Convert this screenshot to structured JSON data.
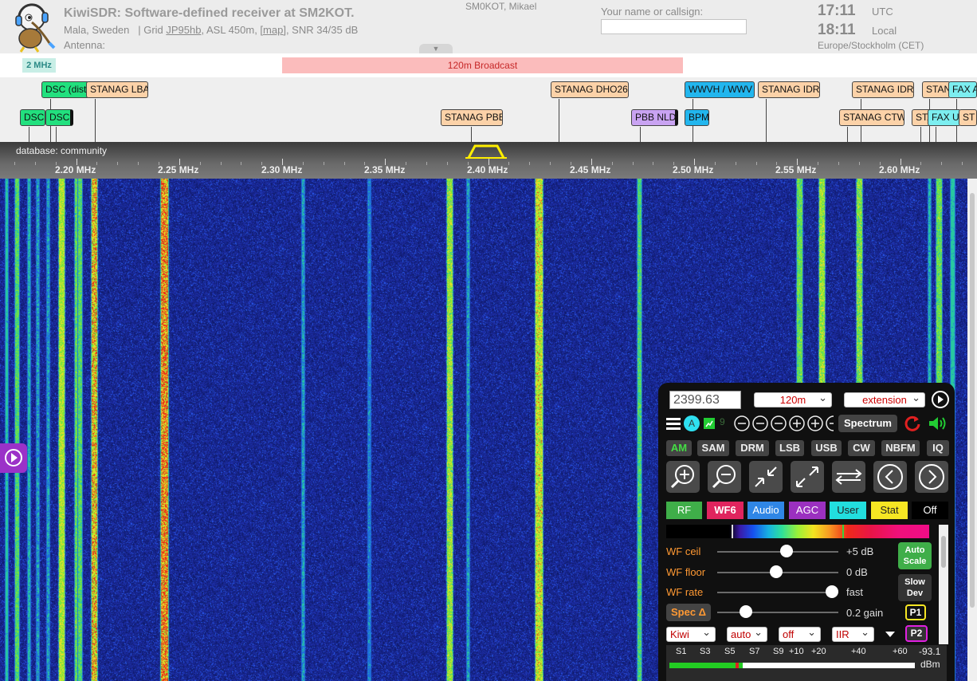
{
  "header": {
    "title": "KiwiSDR: Software-defined receiver at SM2KOT.",
    "location_prefix": "Mala, Sweden   | Grid ",
    "grid": "JP95hb",
    "asl": ", ASL 450m, ",
    "map": "[map]",
    "snr": ", SNR 34/35 dB",
    "antenna": "Antenna:",
    "owner": "SM0KOT, Mikael",
    "callsign_label": "Your name or callsign:",
    "callsign_value": "",
    "utc_time": "17:11",
    "utc_label": "UTC",
    "local_time": "18:11",
    "local_label": "Local",
    "timezone": "Europe/Stockholm (CET)"
  },
  "bands": {
    "left_label": "2 MHz",
    "broadcast_label": "120m Broadcast"
  },
  "station_labels": [
    {
      "text": "DSC (distress)",
      "color": "green"
    },
    {
      "text": "STANAG LBA",
      "color": "tan"
    },
    {
      "text": "DSC",
      "color": "green"
    },
    {
      "text": "DSC",
      "color": "green"
    },
    {
      "text": "STANAG PBB",
      "color": "tan"
    },
    {
      "text": "STANAG DHO26",
      "color": "tan"
    },
    {
      "text": "PBB NLD",
      "color": "violet"
    },
    {
      "text": "WWVH / WWV",
      "color": "blue"
    },
    {
      "text": "BPM",
      "color": "blue"
    },
    {
      "text": "STANAG IDR",
      "color": "tan"
    },
    {
      "text": "STANAG IDR",
      "color": "tan"
    },
    {
      "text": "STANAG CTW",
      "color": "tan"
    },
    {
      "text": "STAN",
      "color": "tan"
    },
    {
      "text": "FAX A",
      "color": "cyan"
    },
    {
      "text": "STA",
      "color": "tan"
    },
    {
      "text": "FAX UK",
      "color": "cyan"
    },
    {
      "text": "ST",
      "color": "tan"
    }
  ],
  "scale": {
    "database": "database: community",
    "ticks": [
      "2.20 MHz",
      "2.25 MHz",
      "2.30 MHz",
      "2.35 MHz",
      "2.40 MHz",
      "2.45 MHz",
      "2.50 MHz",
      "2.55 MHz",
      "2.60 MHz"
    ]
  },
  "waterfall": {
    "colors": {
      "background": "#0f1a78",
      "signal_low": "#2ecc9a",
      "signal_mid": "#e6e028",
      "signal_high": "#ee2a1a"
    }
  },
  "panel": {
    "frequency": "2399.63",
    "band_select": "120m",
    "extension_select": "extension",
    "spectrum_label": "Spectrum",
    "badge_a": "A",
    "badge_9": "9",
    "modes": [
      "AM",
      "SAM",
      "DRM",
      "LSB",
      "USB",
      "CW",
      "NBFM",
      "IQ"
    ],
    "active_mode": "AM",
    "tabs": [
      {
        "label": "RF",
        "bg": "#3fae49",
        "fg": "#ffffff"
      },
      {
        "label": "WF6",
        "bg": "#e0245e",
        "fg": "#ffffff"
      },
      {
        "label": "Audio",
        "bg": "#2f86e6",
        "fg": "#ffffff"
      },
      {
        "label": "AGC",
        "bg": "#9b30c0",
        "fg": "#ffffff"
      },
      {
        "label": "User",
        "bg": "#22dede",
        "fg": "#222222"
      },
      {
        "label": "Stat",
        "bg": "#f6e623",
        "fg": "#222222"
      },
      {
        "label": "Off",
        "bg": "#000000",
        "fg": "#ffffff"
      }
    ],
    "wf_ceil_label": "WF ceil",
    "wf_ceil_value": "+5 dB",
    "wf_floor_label": "WF floor",
    "wf_floor_value": "0 dB",
    "wf_rate_label": "WF rate",
    "wf_rate_value": "fast",
    "spec_label": "Spec Δ",
    "spec_value": "0.2 gain",
    "auto_scale": "Auto Scale",
    "slow_dev": "Slow Dev",
    "p1": "P1",
    "p2": "P2",
    "wf_ceil_level": 0.57,
    "wf_floor_level": 0.49,
    "wf_rate_level": 0.95,
    "spec_level": 0.24,
    "low_selects": [
      {
        "value": "Kiwi",
        "color": "#c00000"
      },
      {
        "value": "auto",
        "color": "#c00000"
      },
      {
        "value": "off",
        "color": "#c00000"
      },
      {
        "value": "IIR",
        "color": "#c00000"
      }
    ],
    "smeter": {
      "labels": [
        "S1",
        "S3",
        "S5",
        "S7",
        "S9",
        "+10",
        "+20",
        "+40",
        "+60"
      ],
      "reading": "-93.1",
      "unit": "dBm",
      "level": 0.3
    }
  }
}
